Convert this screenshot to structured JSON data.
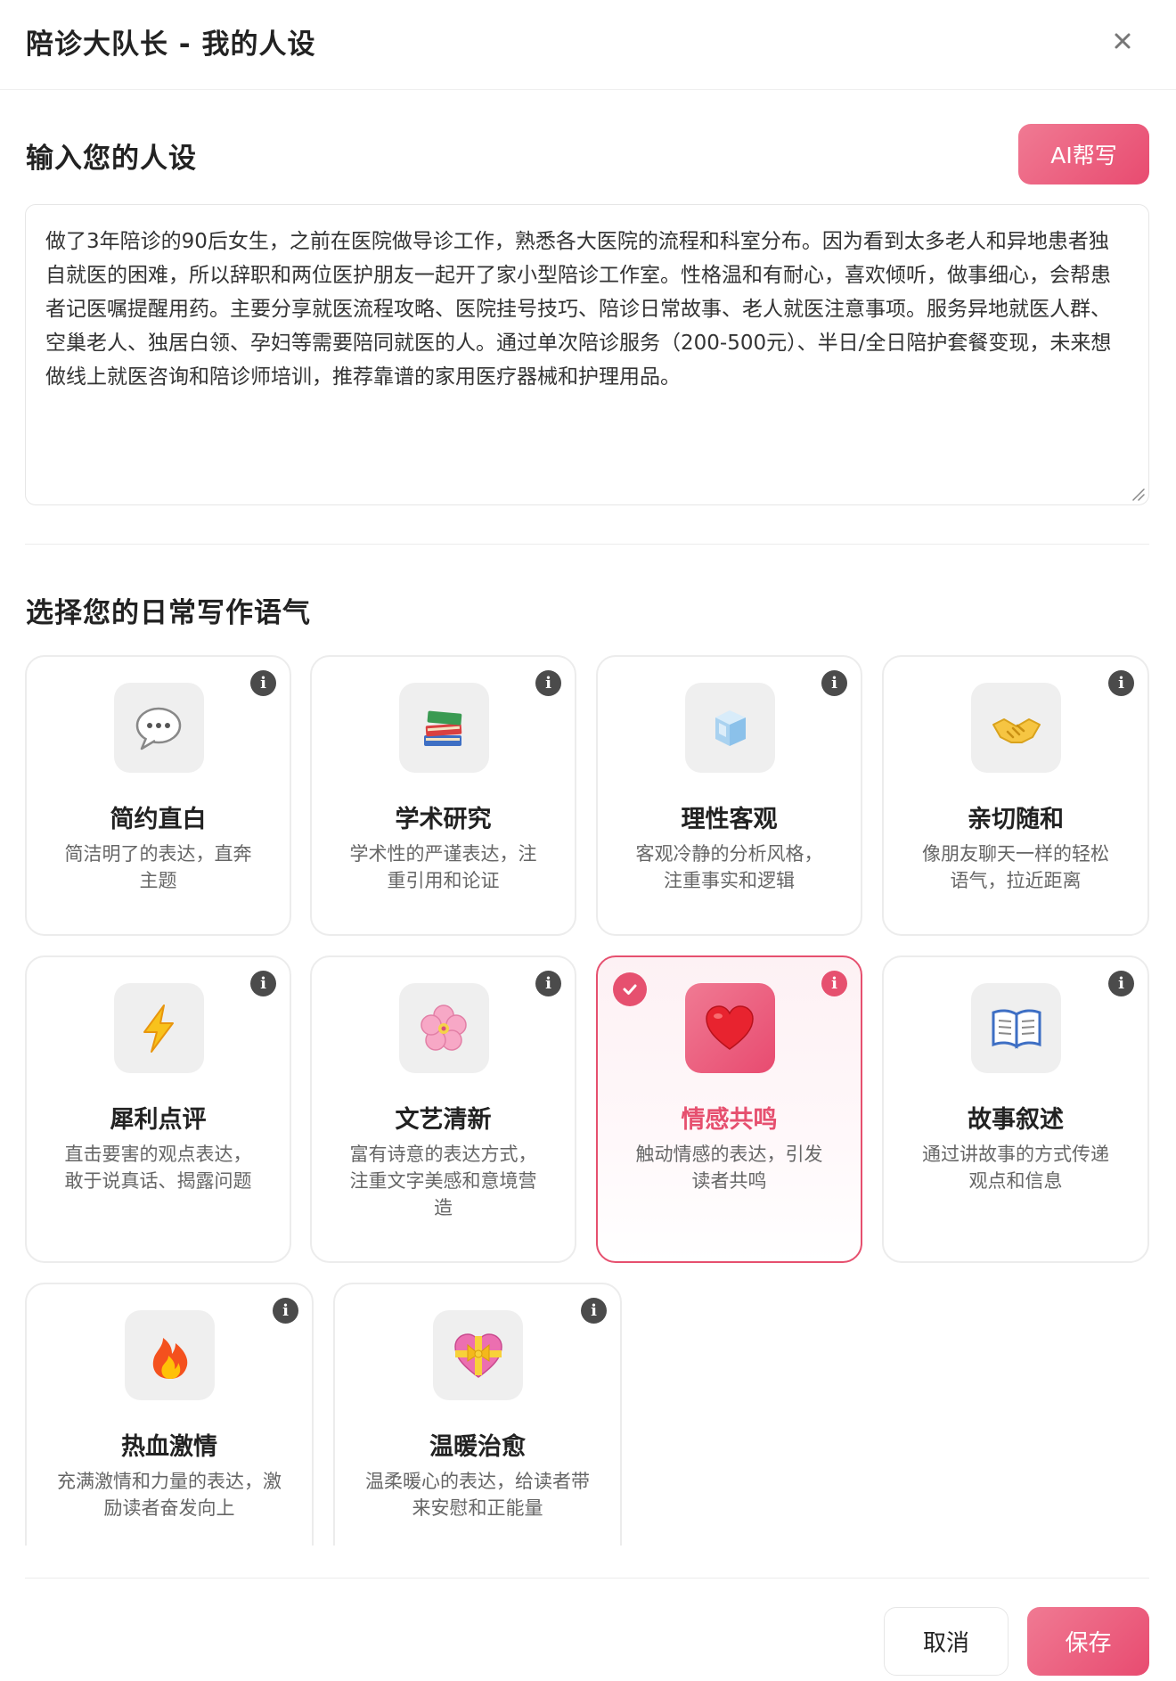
{
  "dialog": {
    "title": "陪诊大队长 - 我的人设",
    "close_icon": "close-icon"
  },
  "persona": {
    "section_title": "输入您的人设",
    "ai_button": "AI帮写",
    "text": "做了3年陪诊的90后女生，之前在医院做导诊工作，熟悉各大医院的流程和科室分布。因为看到太多老人和异地患者独自就医的困难，所以辞职和两位医护朋友一起开了家小型陪诊工作室。性格温和有耐心，喜欢倾听，做事细心，会帮患者记医嘱提醒用药。主要分享就医流程攻略、医院挂号技巧、陪诊日常故事、老人就医注意事项。服务异地就医人群、空巢老人、独居白领、孕妇等需要陪同就医的人。通过单次陪诊服务（200-500元）、半日/全日陪护套餐变现，未来想做线上就医咨询和陪诊师培训，推荐靠谱的家用医疗器械和护理用品。"
  },
  "tone": {
    "section_title": "选择您的日常写作语气",
    "selected": "情感共鸣",
    "accent_color": "#e6506f",
    "cards": [
      {
        "icon": "speech-bubble-icon",
        "name": "简约直白",
        "desc": "简洁明了的表达，直奔主题"
      },
      {
        "icon": "books-icon",
        "name": "学术研究",
        "desc": "学术性的严谨表达，注重引用和论证"
      },
      {
        "icon": "ice-cube-icon",
        "name": "理性客观",
        "desc": "客观冷静的分析风格，注重事实和逻辑"
      },
      {
        "icon": "handshake-icon",
        "name": "亲切随和",
        "desc": "像朋友聊天一样的轻松语气，拉近距离"
      },
      {
        "icon": "lightning-icon",
        "name": "犀利点评",
        "desc": "直击要害的观点表达，敢于说真话、揭露问题"
      },
      {
        "icon": "cherry-blossom-icon",
        "name": "文艺清新",
        "desc": "富有诗意的表达方式，注重文字美感和意境营造"
      },
      {
        "icon": "red-heart-icon",
        "name": "情感共鸣",
        "desc": "触动情感的表达，引发读者共鸣"
      },
      {
        "icon": "open-book-icon",
        "name": "故事叙述",
        "desc": "通过讲故事的方式传递观点和信息"
      },
      {
        "icon": "fire-icon",
        "name": "热血激情",
        "desc": "充满激情和力量的表达，激励读者奋发向上"
      },
      {
        "icon": "heart-with-ribbon-icon",
        "name": "温暖治愈",
        "desc": "温柔暖心的表达，给读者带来安慰和正能量"
      }
    ]
  },
  "footer": {
    "cancel": "取消",
    "save": "保存"
  }
}
